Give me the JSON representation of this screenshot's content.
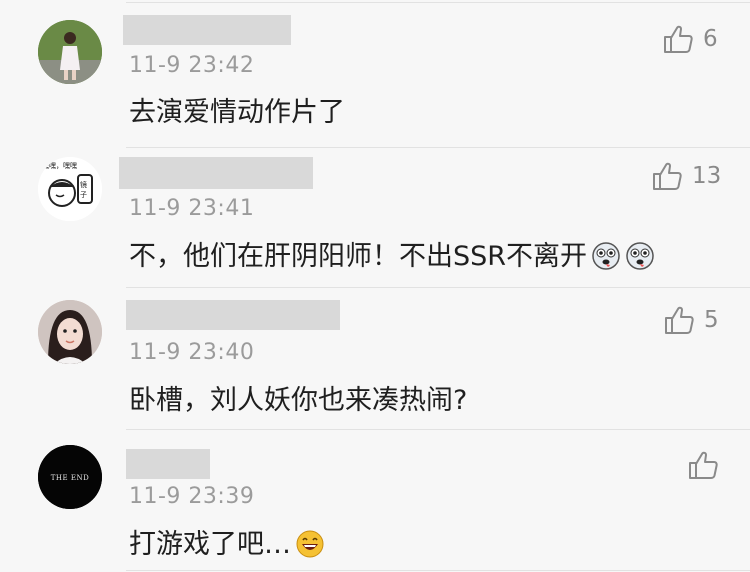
{
  "comments": [
    {
      "time": "11-9 23:42",
      "text": "去演爱情动作片了",
      "likes": "6"
    },
    {
      "time": "11-9 23:41",
      "text": "不，他们在肝阴阳师！不出SSR不离开",
      "likes": "13",
      "avatar_text": "嘿嘿，嘿嘿 \n 镜子"
    },
    {
      "time": "11-9 23:40",
      "text": "卧槽，刘人妖你也来凑热闹?",
      "likes": "5"
    },
    {
      "time": "11-9 23:39",
      "text": "打游戏了吧…",
      "likes": "",
      "avatar_text": "THE END"
    }
  ],
  "icons": {
    "like": "thumbs-up-icon",
    "emoji_dog": "dog-face-emoji-icon",
    "emoji_laugh": "grinning-face-emoji-icon"
  }
}
